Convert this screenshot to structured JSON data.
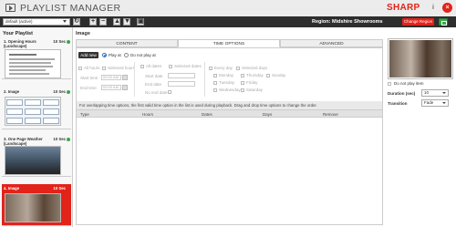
{
  "header": {
    "title": "PLAYLIST MANAGER",
    "brand": "SHARP",
    "info_label": "i",
    "close_label": "×"
  },
  "toolbar": {
    "playlist_select_value": "default (active)",
    "buttons": [
      "+",
      "−",
      "▲",
      "▼"
    ],
    "region_label": "Region: Midshire Showrooms",
    "change_region_label": "Change Region"
  },
  "sidebar": {
    "title": "Your Playlist",
    "items": [
      {
        "name": "1. Opening Hours (Landscape)",
        "duration": "10 Sec",
        "active": true,
        "selected": false
      },
      {
        "name": "2. Image",
        "duration": "10 Sec",
        "active": true,
        "selected": false
      },
      {
        "name": "3. One Page Weather (Landscape)",
        "duration": "10 Sec",
        "active": true,
        "selected": false
      },
      {
        "name": "4. Image",
        "duration": "10 Sec",
        "active": false,
        "selected": true
      }
    ]
  },
  "main": {
    "heading": "Image",
    "tabs": [
      {
        "label": "CONTENT",
        "active": false
      },
      {
        "label": "TIME OPTIONS",
        "active": true
      },
      {
        "label": "ADVANCED",
        "active": false
      }
    ],
    "add_new_label": "Add new",
    "play_at_label": "Play at",
    "do_not_play_at_label": "Do not play at",
    "hours": {
      "all_hours": "All hours",
      "selected_hours": "Selected hours",
      "start_time_label": "Start time",
      "start_time_value": "00:00 AM",
      "end_time_label": "End time",
      "end_time_value": "00:00 AM"
    },
    "dates": {
      "all_dates": "All dates",
      "selected_dates": "Selected dates",
      "start_date_label": "Start date",
      "end_date_label": "End date",
      "no_end_date": "No end date"
    },
    "days": {
      "every_day": "Every day",
      "selected_days": "Selected days",
      "monday": "Monday",
      "tuesday": "Tuesday",
      "wednesday": "Wednesday",
      "thursday": "Thursday",
      "friday": "Friday",
      "saturday": "Saturday",
      "sunday": "Sunday"
    },
    "notice": "For overlapping time options, the first valid time option in the list is used during playback. Drag and drop time options to change the order.",
    "table_columns": [
      "Type",
      "Hours",
      "Dates",
      "Days",
      "Remove"
    ]
  },
  "right": {
    "do_not_play_label": "Do not play item",
    "duration_label": "Duration (sec)",
    "duration_value": "10",
    "transition_label": "Transition",
    "transition_value": "Fade"
  },
  "colors": {
    "brand_red": "#e2231a",
    "toolbar_dark": "#2e2e2e",
    "status_green": "#39a84a"
  }
}
